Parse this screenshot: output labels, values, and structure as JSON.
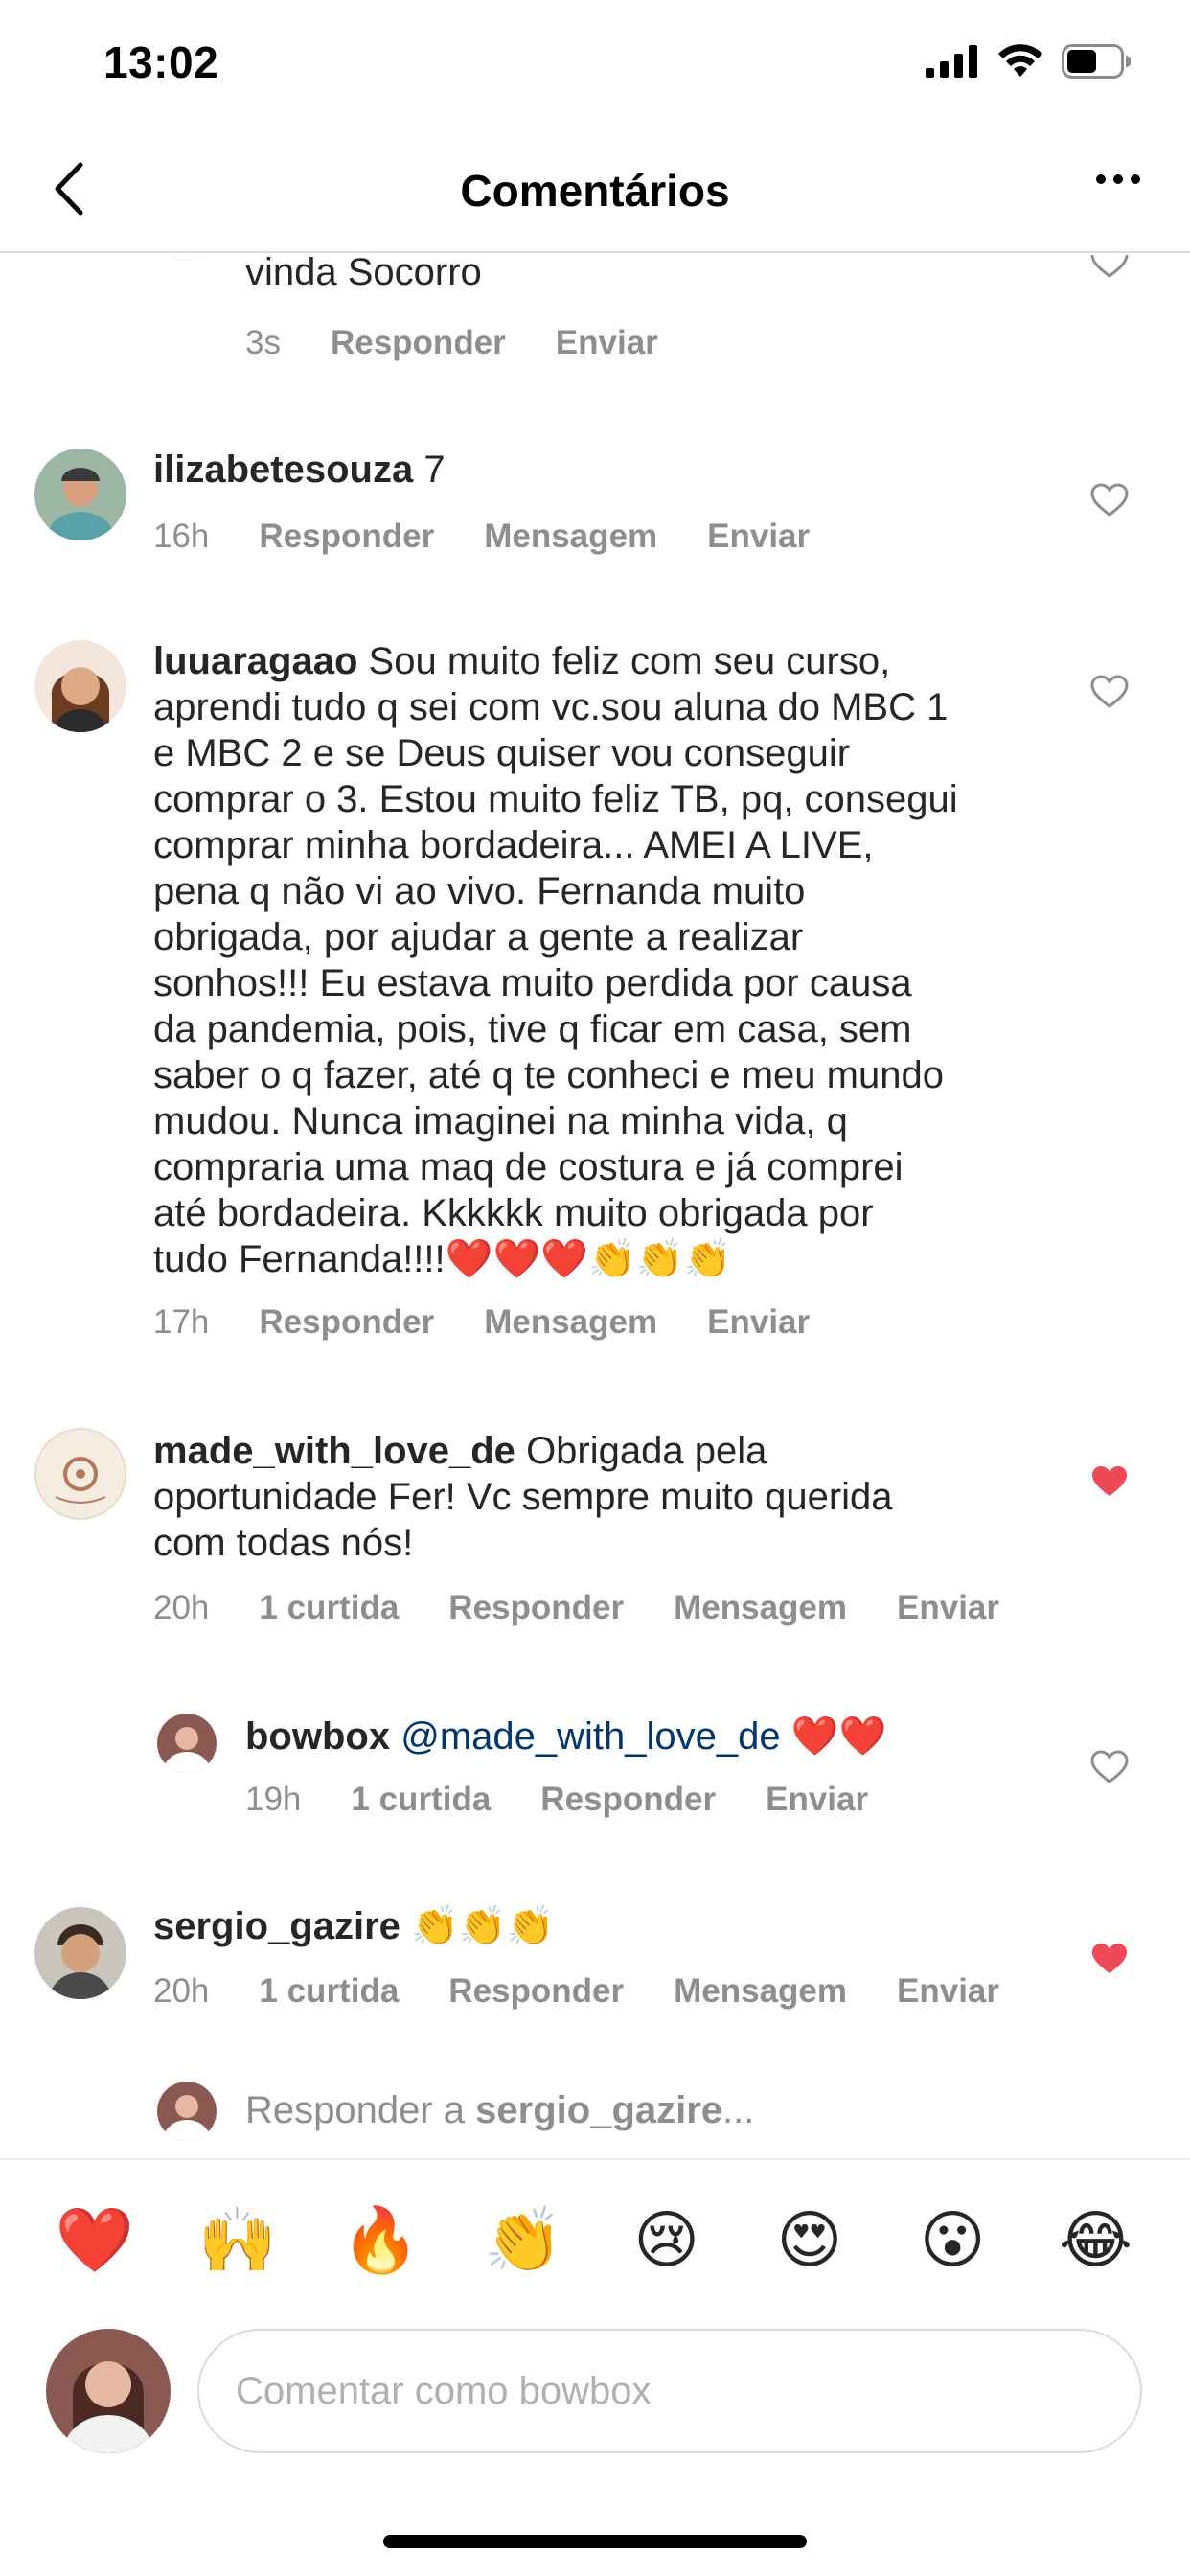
{
  "status": {
    "time": "13:02"
  },
  "header": {
    "title": "Comentários"
  },
  "comments": [
    {
      "username": "",
      "text": "vinda Socorro",
      "time": "3s",
      "likes": "",
      "actions": [
        "Responder",
        "Enviar"
      ],
      "liked": false
    },
    {
      "username": "ilizabetesouza",
      "text": "7",
      "time": "16h",
      "likes": "",
      "actions": [
        "Responder",
        "Mensagem",
        "Enviar"
      ],
      "liked": false
    },
    {
      "username": "luuaragaao",
      "text_lines": [
        "Sou muito feliz com seu curso,",
        "aprendi tudo q sei com vc.sou aluna do MBC 1",
        "e MBC 2 e se Deus quiser vou conseguir",
        "comprar o 3. Estou muito feliz TB, pq, consegui",
        "comprar minha bordadeira... AMEI A LIVE,",
        "pena q não vi ao vivo.  Fernanda muito",
        "obrigada, por ajudar a gente a realizar",
        "sonhos!!! Eu estava muito perdida por causa",
        "da pandemia, pois, tive q ficar em casa, sem",
        "saber o q fazer, até q te conheci e meu mundo",
        "mudou. Nunca imaginei na minha vida, q",
        "compraria uma maq de costura e já comprei",
        "até bordadeira. Kkkkkk muito obrigada por",
        "tudo Fernanda!!!!❤️❤️❤️👏👏👏"
      ],
      "time": "17h",
      "likes": "",
      "actions": [
        "Responder",
        "Mensagem",
        "Enviar"
      ],
      "liked": false
    },
    {
      "username": "made_with_love_de",
      "text_lines": [
        "Obrigada pela",
        "oportunidade Fer! Vc sempre muito querida",
        "com todas nós!"
      ],
      "time": "20h",
      "likes": "1 curtida",
      "actions": [
        "Responder",
        "Mensagem",
        "Enviar"
      ],
      "liked": true
    },
    {
      "username": "bowbox",
      "mention": "@made_with_love_de",
      "text": " ❤️❤️",
      "time": "19h",
      "likes": "1 curtida",
      "actions": [
        "Responder",
        "Enviar"
      ],
      "liked": false
    },
    {
      "username": "sergio_gazire",
      "text": "👏👏👏",
      "time": "20h",
      "likes": "1 curtida",
      "actions": [
        "Responder",
        "Mensagem",
        "Enviar"
      ],
      "liked": true
    }
  ],
  "reply_prompt": {
    "prefix": "Responder a ",
    "username": "sergio_gazire",
    "suffix": "..."
  },
  "emoji_bar": [
    "❤️",
    "🙌",
    "🔥",
    "👏",
    "😢",
    "😍",
    "😮",
    "😂"
  ],
  "composer": {
    "placeholder": "Comentar como bowbox"
  },
  "colors": {
    "like_red": "#ed4956",
    "mention_blue": "#00376b",
    "meta_gray": "#8e8e8e"
  }
}
